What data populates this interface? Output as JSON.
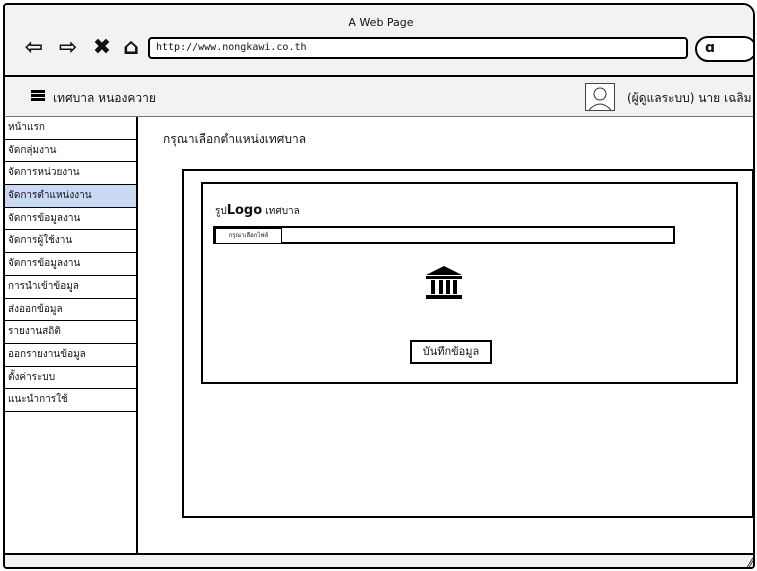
{
  "window": {
    "title": "A Web Page",
    "url": "http://www.nongkawi.co.th"
  },
  "header": {
    "brand": "เทศบาล หนองควาย",
    "user_role": "(ผู้ดูแลระบบ) นาย เฉลิม"
  },
  "sidebar": {
    "items": [
      {
        "label": "หน้าแรก"
      },
      {
        "label": "จัดกลุ่มงาน"
      },
      {
        "label": "จัดการหน่วยงาน"
      },
      {
        "label": "จัดการตำแหน่งงาน"
      },
      {
        "label": "จัดการข้อมูลงาน"
      },
      {
        "label": "จัดการผู้ใช้งาน"
      },
      {
        "label": "จัดการข้อมูลงาน"
      },
      {
        "label": "การนำเข้าข้อมูล"
      },
      {
        "label": "ส่งออกข้อมูล"
      },
      {
        "label": "รายงานสถิติ"
      },
      {
        "label": "ออกรายงานข้อมูล"
      },
      {
        "label": "ตั้งค่าระบบ"
      },
      {
        "label": "แนะนำการใช้"
      }
    ],
    "active_index": 3
  },
  "main": {
    "title": "กรุณาเลือกตำแหน่งเทศบาล",
    "logo_label_prefix": "รูป",
    "logo_label_logo": "Logo",
    "logo_label_suffix": " เทศบาล",
    "file_button": "กรุณาเลือกไฟล์",
    "save_button": "บันทึกข้อมูล"
  },
  "icons": {
    "back": "back-arrow-icon",
    "forward": "forward-arrow-icon",
    "close": "close-icon",
    "home": "home-icon",
    "search": "search-icon",
    "menu": "menu-icon",
    "avatar": "user-avatar-icon",
    "logo": "government-building-icon"
  },
  "colors": {
    "active_item": "#c9d8f3",
    "chrome": "#f2f2f2"
  }
}
